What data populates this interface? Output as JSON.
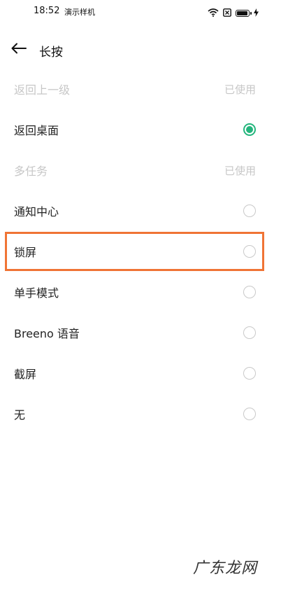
{
  "status_bar": {
    "time": "18:52",
    "carrier": "演示样机",
    "icons": [
      "wifi-icon",
      "sim-icon",
      "battery-icon",
      "charging-icon"
    ]
  },
  "header": {
    "back_icon": "arrow-left-icon",
    "title": "长按"
  },
  "options": [
    {
      "label": "返回上一级",
      "disabled": true,
      "status": "已使用"
    },
    {
      "label": "返回桌面",
      "selected": true
    },
    {
      "label": "多任务",
      "disabled": true,
      "status": "已使用"
    },
    {
      "label": "通知中心"
    },
    {
      "label": "锁屏",
      "highlighted": true
    },
    {
      "label": "单手模式"
    },
    {
      "label": "Breeno 语音"
    },
    {
      "label": "截屏"
    },
    {
      "label": "无"
    }
  ],
  "watermark": "广东龙网",
  "colors": {
    "accent": "#24b57d",
    "highlight": "#f07435",
    "disabled_text": "#c7c7c7"
  }
}
